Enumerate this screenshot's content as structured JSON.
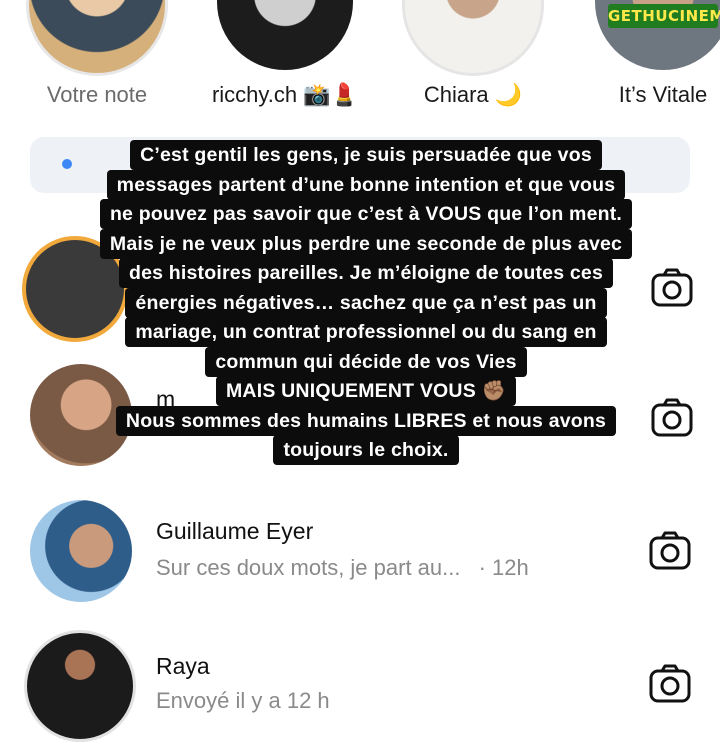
{
  "stories": [
    {
      "label": "Votre note"
    },
    {
      "label": "ricchy.ch 📸💄"
    },
    {
      "label": "Chiara 🌙"
    },
    {
      "label": "It’s Vitale"
    }
  ],
  "threads": [
    {
      "name": "Guillaume Eyer",
      "preview": "Sur ces doux mots, je part au...",
      "time": "· 12h"
    },
    {
      "name": "Raya",
      "preview": "Envoyé il y a 12 h"
    }
  ],
  "partial_thread_initial": "m",
  "overlay_lines": [
    "C’est gentil les gens, je suis persuadée que vos",
    "messages partent d’une bonne intention et que vous",
    "ne pouvez pas savoir que c’est à VOUS que l’on ment.",
    "Mais je ne veux plus perdre une seconde de plus avec",
    "des histoires pareilles. Je m’éloigne de toutes ces",
    "énergies négatives… sachez que ça n’est pas un",
    "mariage, un contrat professionnel ou du sang en",
    "commun qui décide de vos Vies",
    "MAIS UNIQUEMENT VOUS ✊🏽",
    "Nous sommes des humains LIBRES et nous avons",
    "toujours le choix."
  ],
  "watermark": "GETHUCINEMA",
  "icons": {
    "camera": "camera-icon"
  },
  "colors": {
    "overlay_bg": "#0c0c0c",
    "story_ring": "#f2a93b",
    "muted_text": "#8a8a8a"
  }
}
